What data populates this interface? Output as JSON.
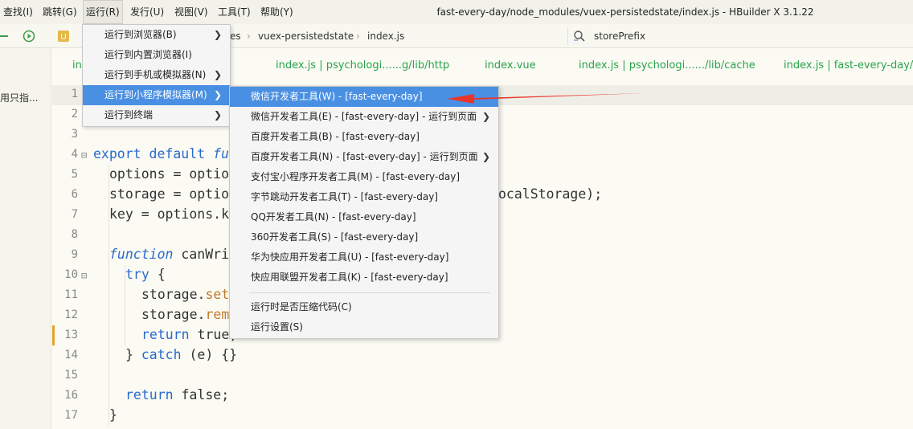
{
  "window": {
    "title": "fast-every-day/node_modules/vuex-persistedstate/index.js - HBuilder X 3.1.22"
  },
  "menubar": {
    "items": [
      "查找(I)",
      "跳转(G)",
      "运行(R)",
      "发行(U)",
      "视图(V)",
      "工具(T)",
      "帮助(Y)"
    ],
    "active_index": 2
  },
  "toolbar": {
    "breadcrumb": [
      "es",
      "vuex-persistedstate",
      "index.js"
    ],
    "search_text": "storePrefix"
  },
  "sidebar": {
    "text": "用只指..."
  },
  "editor": {
    "tabs": [
      "in",
      "index.js | psychologi......g/lib/http",
      "index.vue",
      "index.js | psychologi....../lib/cache",
      "index.js | fast-every-day/lib"
    ],
    "line_numbers": [
      "1",
      "2",
      "3",
      "4",
      "5",
      "6",
      "7",
      "8",
      "9",
      "10",
      "11",
      "12",
      "13",
      "14",
      "15",
      "16",
      "17"
    ],
    "line4": {
      "kw": "export default",
      "fn": "fu"
    },
    "line5": "options = optio",
    "line6_start": "storage = optio",
    "line6_end": "ocalStorage);",
    "line7": "key = options.k",
    "line9": {
      "kw": "function",
      "fn": "canWri"
    },
    "line10": {
      "kw": "try",
      "rest": " {"
    },
    "line11": {
      "pre": "storage.",
      "mth": "set"
    },
    "line12": {
      "pre": "storage.",
      "mth": "rem"
    },
    "line13": {
      "kw": "return",
      "rest": " true;"
    },
    "line14": {
      "pre": "} ",
      "kw": "catch",
      "rest": " (e) {}"
    },
    "line16": {
      "kw": "return",
      "rest": " false;"
    },
    "line17": "}"
  },
  "run_menu": {
    "items": [
      {
        "label": "运行到浏览器(B)",
        "has_submenu": true
      },
      {
        "label": "运行到内置浏览器(I)",
        "has_submenu": false
      },
      {
        "label": "运行到手机或模拟器(N)",
        "has_submenu": true
      },
      {
        "label": "运行到小程序模拟器(M)",
        "has_submenu": true
      },
      {
        "label": "运行到终端",
        "has_submenu": true
      }
    ],
    "highlight_index": 3
  },
  "submenu": {
    "items": [
      {
        "label": "微信开发者工具(W) - [fast-every-day]",
        "has_submenu": false
      },
      {
        "label": "微信开发者工具(E) - [fast-every-day] - 运行到页面",
        "has_submenu": true
      },
      {
        "label": "百度开发者工具(B) - [fast-every-day]",
        "has_submenu": false
      },
      {
        "label": "百度开发者工具(N) - [fast-every-day] - 运行到页面",
        "has_submenu": true
      },
      {
        "label": "支付宝小程序开发者工具(M) - [fast-every-day]",
        "has_submenu": false
      },
      {
        "label": "字节跳动开发者工具(T) - [fast-every-day]",
        "has_submenu": false
      },
      {
        "label": "QQ开发者工具(N) - [fast-every-day]",
        "has_submenu": false
      },
      {
        "label": "360开发者工具(S) - [fast-every-day]",
        "has_submenu": false
      },
      {
        "label": "华为快应用开发者工具(U) - [fast-every-day]",
        "has_submenu": false
      },
      {
        "label": "快应用联盟开发者工具(K) - [fast-every-day]",
        "has_submenu": false
      }
    ],
    "extra_items": [
      "运行时是否压缩代码(C)",
      "运行设置(S)"
    ],
    "highlight_index": 0
  },
  "colors": {
    "accent": "#4a90e2",
    "tab_text": "#2aa24c",
    "annotation": "#e8362b"
  }
}
